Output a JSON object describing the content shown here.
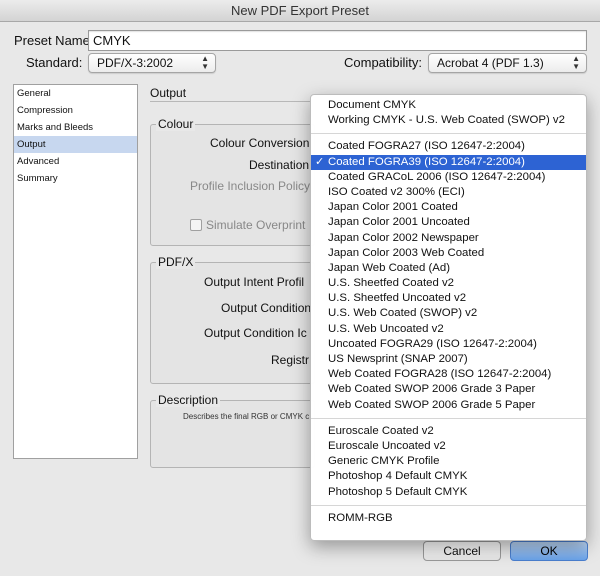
{
  "window": {
    "title": "New PDF Export Preset"
  },
  "preset": {
    "label": "Preset Name:",
    "value": "CMYK"
  },
  "standard": {
    "label": "Standard:",
    "value": "PDF/X-3:2002"
  },
  "compatibility": {
    "label": "Compatibility:",
    "value": "Acrobat 4 (PDF 1.3)"
  },
  "sidebar": {
    "items": [
      {
        "label": "General"
      },
      {
        "label": "Compression"
      },
      {
        "label": "Marks and Bleeds"
      },
      {
        "label": "Output"
      },
      {
        "label": "Advanced"
      },
      {
        "label": "Summary"
      }
    ]
  },
  "main": {
    "section_title": "Output",
    "colour": {
      "title": "Colour",
      "colour_conversion": "Colour Conversion",
      "destination": "Destination",
      "profile_inclusion": "Profile Inclusion Policy",
      "simulate_overprint": "Simulate Overprint"
    },
    "pdfx": {
      "title": "PDF/X",
      "output_intent": "Output Intent Profil",
      "output_condition": "Output Condition",
      "output_condition_id": "Output Condition Ic",
      "registry": "Registr"
    },
    "description": {
      "title": "Description",
      "text": "Describes the final RGB or CMYK c"
    }
  },
  "buttons": {
    "cancel": "Cancel",
    "ok": "OK"
  },
  "menu": {
    "group1": [
      "Document CMYK",
      "Working CMYK - U.S. Web Coated (SWOP) v2"
    ],
    "group2": [
      "Coated FOGRA27 (ISO 12647-2:2004)",
      "Coated FOGRA39 (ISO 12647-2:2004)",
      "Coated GRACoL 2006 (ISO 12647-2:2004)",
      "ISO Coated v2 300% (ECI)",
      "Japan Color 2001 Coated",
      "Japan Color 2001 Uncoated",
      "Japan Color 2002 Newspaper",
      "Japan Color 2003 Web Coated",
      "Japan Web Coated (Ad)",
      "U.S. Sheetfed Coated v2",
      "U.S. Sheetfed Uncoated v2",
      "U.S. Web Coated (SWOP) v2",
      "U.S. Web Uncoated v2",
      "Uncoated FOGRA29 (ISO 12647-2:2004)",
      "US Newsprint (SNAP 2007)",
      "Web Coated FOGRA28 (ISO 12647-2:2004)",
      "Web Coated SWOP 2006 Grade 3 Paper",
      "Web Coated SWOP 2006 Grade 5 Paper"
    ],
    "group3": [
      "Euroscale Coated v2",
      "Euroscale Uncoated v2",
      "Generic CMYK Profile",
      "Photoshop 4 Default CMYK",
      "Photoshop 5 Default CMYK"
    ],
    "group4": [
      "ROMM-RGB"
    ],
    "selected": "Coated FOGRA39 (ISO 12647-2:2004)",
    "check_glyph": "✓"
  },
  "colors": {
    "accent": "#2d63d3",
    "sidebar_selected": "#c7d7ef"
  }
}
